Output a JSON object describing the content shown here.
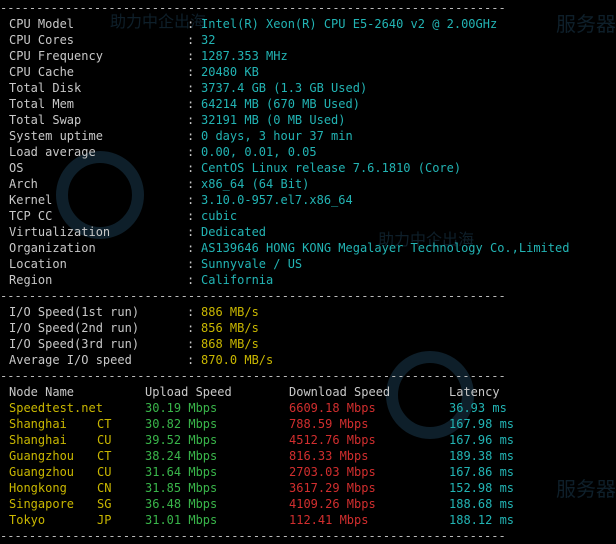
{
  "system_info": [
    {
      "label": "CPU Model",
      "value": "Intel(R) Xeon(R) CPU E5-2640 v2 @ 2.00GHz"
    },
    {
      "label": "CPU Cores",
      "value": "32"
    },
    {
      "label": "CPU Frequency",
      "value": "1287.353 MHz"
    },
    {
      "label": "CPU Cache",
      "value": "20480 KB"
    },
    {
      "label": "Total Disk",
      "value": "3737.4 GB (1.3 GB Used)"
    },
    {
      "label": "Total Mem",
      "value": "64214 MB (670 MB Used)"
    },
    {
      "label": "Total Swap",
      "value": "32191 MB (0 MB Used)"
    },
    {
      "label": "System uptime",
      "value": "0 days, 3 hour 37 min"
    },
    {
      "label": "Load average",
      "value": "0.00, 0.01, 0.05"
    },
    {
      "label": "OS",
      "value": "CentOS Linux release 7.6.1810 (Core)"
    },
    {
      "label": "Arch",
      "value": "x86_64 (64 Bit)"
    },
    {
      "label": "Kernel",
      "value": "3.10.0-957.el7.x86_64"
    },
    {
      "label": "TCP CC",
      "value": "cubic"
    },
    {
      "label": "Virtualization",
      "value": "Dedicated"
    },
    {
      "label": "Organization",
      "value": "AS139646 HONG KONG Megalayer Technology Co.,Limited"
    },
    {
      "label": "Location",
      "value": "Sunnyvale / US"
    },
    {
      "label": "Region",
      "value": "California"
    }
  ],
  "colon": ":",
  "separator": "----------------------------------------------------------------------",
  "io": [
    {
      "label": "I/O Speed(1st run)",
      "value": "886 MB/s"
    },
    {
      "label": "I/O Speed(2nd run)",
      "value": "856 MB/s"
    },
    {
      "label": "I/O Speed(3rd run)",
      "value": "868 MB/s"
    },
    {
      "label": "Average I/O speed",
      "value": "870.0 MB/s"
    }
  ],
  "speed_headers": {
    "node": "Node Name",
    "upload": "Upload Speed",
    "download": "Download Speed",
    "latency": "Latency"
  },
  "speed_rows": [
    {
      "node": "Speedtest.net",
      "cc": "",
      "upload": "30.19 Mbps",
      "download": "6609.18 Mbps",
      "latency": "36.93 ms"
    },
    {
      "node": "Shanghai",
      "cc": "CT",
      "upload": "30.82 Mbps",
      "download": "788.59 Mbps",
      "latency": "167.98 ms"
    },
    {
      "node": "Shanghai",
      "cc": "CU",
      "upload": "39.52 Mbps",
      "download": "4512.76 Mbps",
      "latency": "167.96 ms"
    },
    {
      "node": "Guangzhou",
      "cc": "CT",
      "upload": "38.24 Mbps",
      "download": "816.33 Mbps",
      "latency": "189.38 ms"
    },
    {
      "node": "Guangzhou",
      "cc": "CU",
      "upload": "31.64 Mbps",
      "download": "2703.03 Mbps",
      "latency": "167.86 ms"
    },
    {
      "node": "Hongkong",
      "cc": "CN",
      "upload": "31.85 Mbps",
      "download": "3617.29 Mbps",
      "latency": "152.98 ms"
    },
    {
      "node": "Singapore",
      "cc": "SG",
      "upload": "36.48 Mbps",
      "download": "4109.26 Mbps",
      "latency": "188.68 ms"
    },
    {
      "node": "Tokyo",
      "cc": "JP",
      "upload": "31.01 Mbps",
      "download": "112.41 Mbps",
      "latency": "188.12 ms"
    }
  ],
  "watermarks": [
    "服务器",
    "助力中企出海",
    "服务器",
    "服务器",
    "助力中企出海",
    "服务器"
  ],
  "colors": {
    "background": "#000000",
    "label": "#c8c8c8",
    "value_cyan": "#22b4b4",
    "io_yellow": "#c9b700",
    "upload_green": "#39b54a",
    "download_red": "#d12e2e"
  }
}
